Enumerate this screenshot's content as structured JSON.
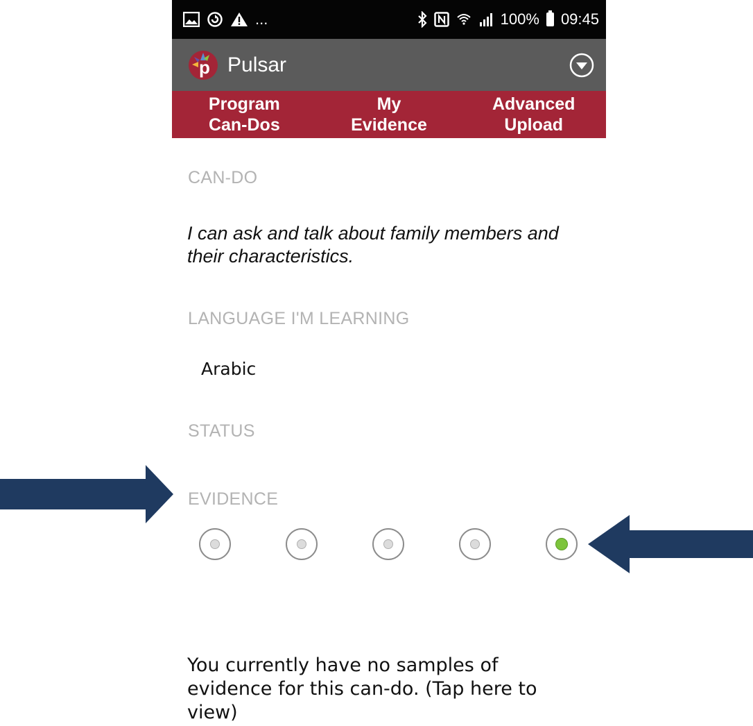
{
  "status_bar": {
    "left_icons": [
      "image-icon",
      "sync-icon",
      "warning-icon"
    ],
    "left_more": "...",
    "right_icons": [
      "bluetooth-icon",
      "nfc-icon",
      "wifi-icon",
      "signal-icon"
    ],
    "battery": "100%",
    "time": "09:45"
  },
  "app_bar": {
    "title": "Pulsar",
    "menu_icon": "chevron-down-circle-icon",
    "colors": {
      "background": "#5b5b5b"
    }
  },
  "tabs": [
    {
      "line1": "Program",
      "line2": "Can-Dos"
    },
    {
      "line1": "My",
      "line2": "Evidence"
    },
    {
      "line1": "Advanced",
      "line2": "Upload"
    }
  ],
  "tab_color": "#a32537",
  "content": {
    "cando_label": "CAN-DO",
    "cando_text": "I can ask and talk about family members and their characteristics.",
    "language_label": "LANGUAGE I'M LEARNING",
    "language_value": "Arabic",
    "status_label": "STATUS",
    "status_options_count": 5,
    "status_selected_index": 4,
    "evidence_label": "EVIDENCE",
    "evidence_text": "You currently have no samples of evidence for this can-do. (Tap here to view)"
  },
  "annotations": {
    "arrow_color": "#1f3a60"
  }
}
